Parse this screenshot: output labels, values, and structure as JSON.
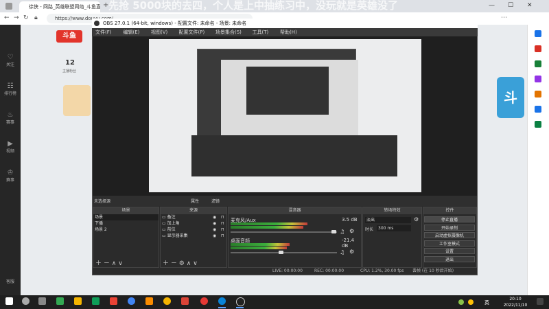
{
  "browser": {
    "tab_title": "徐侠 - 网路_英雄联盟网络_斗鱼直播",
    "address": "https://www.douyu.com/",
    "danmaku": "先抢 5000块的去四，个人是上中抽练习中，没玩就是英雄没了",
    "win_min": "—",
    "win_max": "☐",
    "win_close": "✕"
  },
  "douyu": {
    "logo": "斗鱼",
    "count": "12",
    "count_label": "主播粉丝",
    "nav": [
      {
        "icon": "heart-icon",
        "glyph": "♡",
        "label": "关注"
      },
      {
        "icon": "rank-icon",
        "glyph": "☷",
        "label": "排行榜"
      },
      {
        "icon": "fire-icon",
        "glyph": "♨",
        "label": "赛事"
      },
      {
        "icon": "video-icon",
        "glyph": "▶",
        "label": "视频"
      },
      {
        "icon": "trophy-icon",
        "glyph": "♔",
        "label": "赛事"
      }
    ],
    "bottom_nav": "客服"
  },
  "obs": {
    "title": "OBS 27.0.1 (64-bit, windows) - 配置文件: 未命名 - 场景: 未命名",
    "menu": [
      "文件(F)",
      "编辑(E)",
      "视图(V)",
      "配置文件(P)",
      "场景集合(S)",
      "工具(T)",
      "帮助(H)"
    ],
    "scene_bar": {
      "label": "未选择源",
      "properties": "属性",
      "filters": "滤镜"
    },
    "scenes": {
      "header": "场景",
      "items": [
        "场景",
        "下播",
        "场景 2"
      ]
    },
    "sources": {
      "header": "来源",
      "items": [
        "备注",
        "加上角",
        "前位",
        "显示器采集"
      ]
    },
    "mixer": {
      "header": "混音器",
      "channels": [
        {
          "name": "麦克风/Aux",
          "db": "3.5 dB",
          "level": 0.62
        },
        {
          "name": "桌面音频",
          "db": "-21.4 dB",
          "level": 0.48
        }
      ]
    },
    "transitions": {
      "header": "转场特效",
      "type": "淡出",
      "duration_label": "时长",
      "duration": "300 ms"
    },
    "controls": {
      "header": "控件",
      "buttons": [
        "停止直播",
        "开始录制",
        "启动虚拟摄像机",
        "工作室模式",
        "设置",
        "退出"
      ]
    },
    "status": {
      "live": "LIVE: 00:00:00",
      "rec": "REC: 00:00:00",
      "cpu": "CPU: 1.2%, 30.00 fps",
      "dropped": "丢帧 (在 10 秒后开始)"
    }
  },
  "taskbar": {
    "time": "20:10",
    "date": "2022/11/10",
    "ime": "英"
  },
  "colors": {
    "obs_bg": "#2b2b2b",
    "accent_red": "#e2342b",
    "meter_green": "#3cae3c"
  }
}
